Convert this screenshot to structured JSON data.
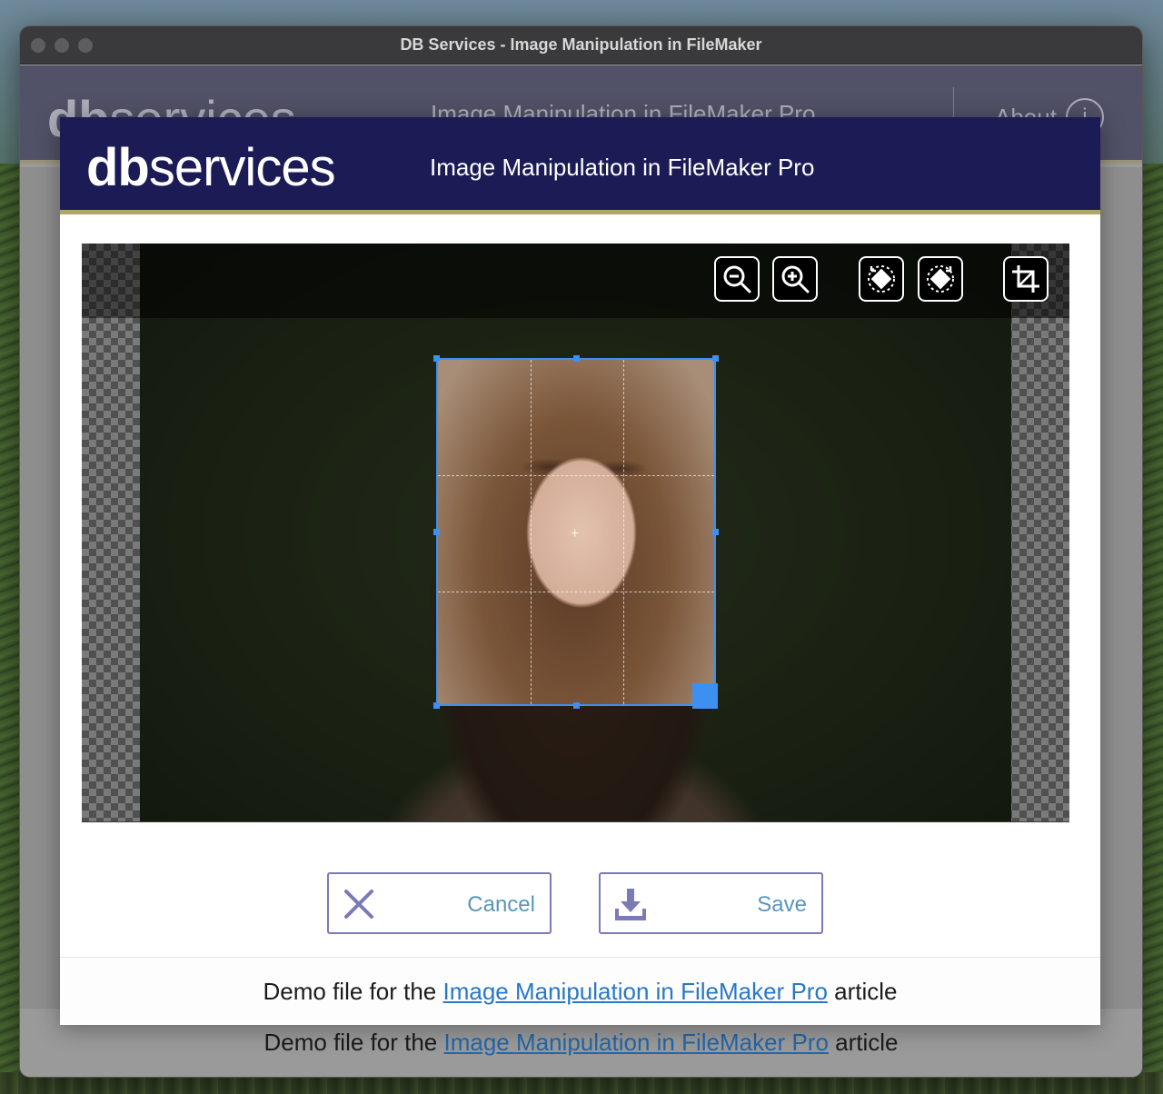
{
  "window": {
    "title": "DB Services - Image Manipulation in FileMaker"
  },
  "app": {
    "logo_bold": "db",
    "logo_rest": "services",
    "subtitle": "Image Manipulation in FileMaker Pro",
    "about_label": "About",
    "about_icon_glyph": "i"
  },
  "dialog": {
    "logo_bold": "db",
    "logo_rest": "services",
    "title": "Image Manipulation in FileMaker Pro"
  },
  "toolbar": {
    "icons": [
      "zoom-out-icon",
      "zoom-in-icon",
      "rotate-left-icon",
      "rotate-right-icon",
      "crop-icon"
    ]
  },
  "actions": {
    "cancel_label": "Cancel",
    "save_label": "Save"
  },
  "footer": {
    "text_before": "Demo file for the ",
    "link_text": "Image Manipulation in FileMaker Pro",
    "text_after": " article"
  },
  "colors": {
    "header_navy": "#1b1b55",
    "header_border_gold": "#b3a56a",
    "crop_blue": "#3d8ff0",
    "button_border": "#7a7ab8",
    "button_label": "#5a96b8",
    "link_blue": "#2878c8"
  }
}
